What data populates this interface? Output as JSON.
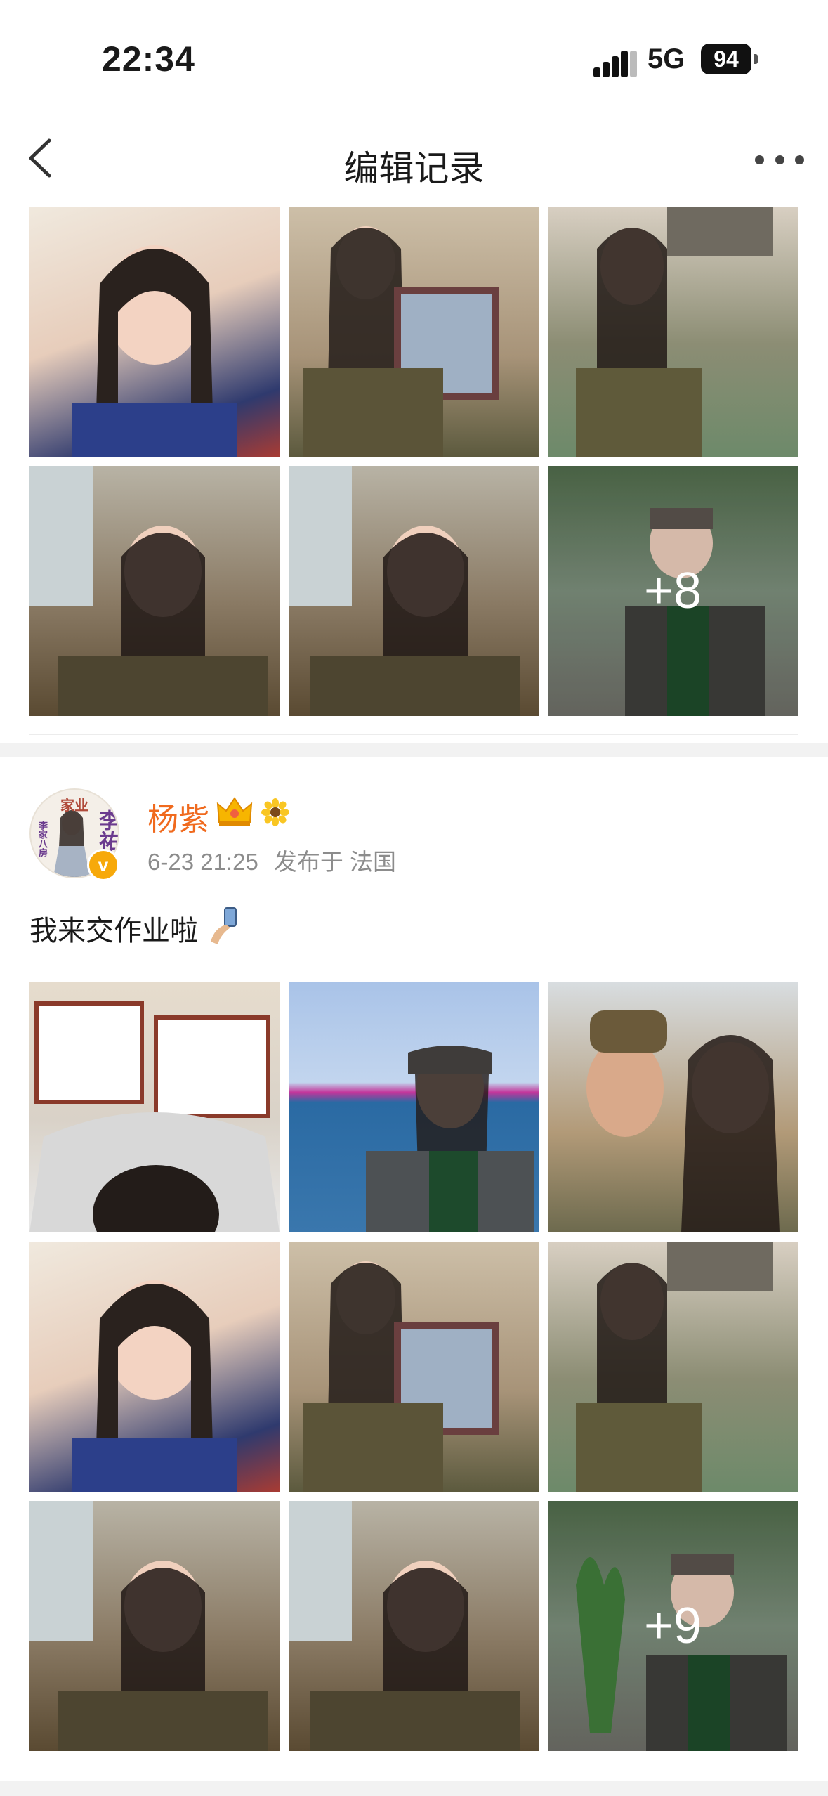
{
  "status": {
    "time": "22:34",
    "network": "5G",
    "battery": "94"
  },
  "nav": {
    "title": "编辑记录",
    "back_icon": "chevron-left-icon",
    "more_icon": "more-dots-icon"
  },
  "top_grid": {
    "more_count": "+8"
  },
  "post": {
    "author": "杨紫",
    "avatar_text": [
      "家业",
      "李家八房",
      "李祐"
    ],
    "verified_icon": "v",
    "date": "6-23 21:25",
    "location": "发布于 法国",
    "text": "我来交作业啦",
    "more_count": "+9"
  },
  "colors": {
    "username": "#f06a1e",
    "meta": "#8c8c8c",
    "badge": "#f7a90a"
  }
}
